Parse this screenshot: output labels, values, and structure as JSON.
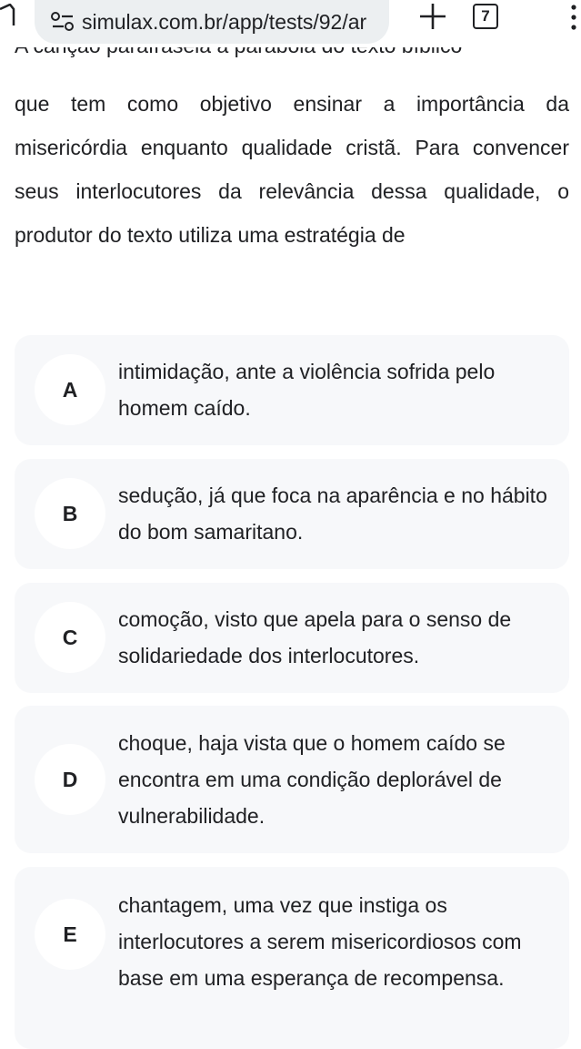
{
  "browser": {
    "url": "simulax.com.br/app/tests/92/ar",
    "tab_count": "7"
  },
  "question": {
    "partial_top_line": "A canção parafraseia a parábola do texto bíblico",
    "text": "que tem como objetivo ensinar a importância da misericórdia enquanto qualidade cristã. Para convencer seus interlocutores da relevância dessa qualidade, o produtor do texto utiliza uma estratégia de"
  },
  "options": [
    {
      "letter": "A",
      "text": "intimidação, ante a violência sofrida pelo homem caído."
    },
    {
      "letter": "B",
      "text": "sedução, já que foca na aparência e no hábito do bom samaritano."
    },
    {
      "letter": "C",
      "text": "comoção, visto que apela para o senso de solidariedade dos interlocutores."
    },
    {
      "letter": "D",
      "text": "choque, haja vista que o homem caído se encontra em uma condição deplorável de vulnerabilidade."
    },
    {
      "letter": "E",
      "text": "chantagem, uma vez que instiga os interlocutores a serem misericordiosos com base em uma esperança de recompensa."
    }
  ]
}
